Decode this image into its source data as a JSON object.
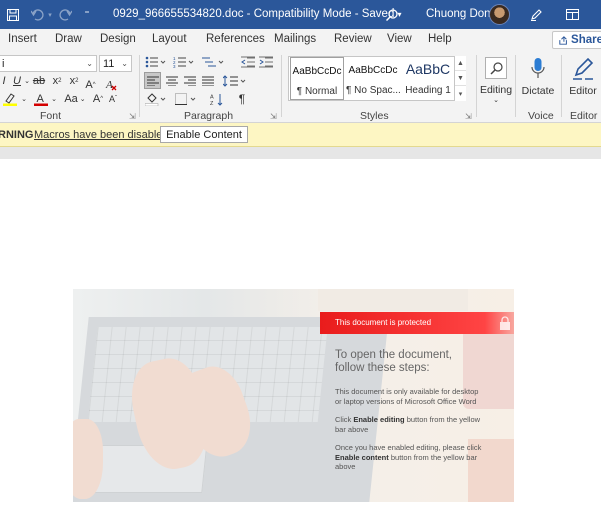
{
  "titlebar": {
    "filename": "0929_966655534820.doc",
    "separator": " - ",
    "mode": "Compatibility Mode",
    "separator2": " - ",
    "status": "Saved",
    "status_caret": "▾",
    "user": "Chuong Dong"
  },
  "tabs": [
    "Insert",
    "Draw",
    "Design",
    "Layout",
    "References",
    "Mailings",
    "Review",
    "View",
    "Help"
  ],
  "share_label": "Share",
  "ribbon": {
    "font_name": "i",
    "font_size": "11",
    "font_group": "Font",
    "paragraph_group": "Paragraph",
    "styles_group": "Styles",
    "voice_group": "Voice",
    "editor_group": "Editor",
    "editing_label": "Editing",
    "dictate_label": "Dictate",
    "editor_label": "Editor",
    "change_case": "Aa",
    "grow": "A",
    "shrink": "A",
    "styles": [
      {
        "preview": "AaBbCcDc",
        "name": "¶ Normal"
      },
      {
        "preview": "AaBbCcDc",
        "name": "¶ No Spac..."
      },
      {
        "preview": "AaBbC",
        "name": "Heading 1"
      }
    ]
  },
  "message_bar": {
    "warning": "RNING",
    "message": "Macros have been disabled.",
    "button": "Enable Content"
  },
  "document": {
    "banner": "This document is protected",
    "heading_line1": "To open the document,",
    "heading_line2": "follow these steps:",
    "para1_line1": "This document is only available for desktop",
    "para1_line2": "or laptop versions of Microsoft Office Word",
    "para2_pre": "Click ",
    "para2_bold": "Enable editing",
    "para2_post": " button from the yellow",
    "para2_line2": "bar above",
    "para3_line1": "Once you have enabled editing, please click",
    "para3_bold": "Enable content",
    "para3_post": " button from the yellow bar",
    "para3_line3": "above"
  },
  "colors": {
    "titlebar": "#2b579a",
    "ribbon": "#f3f3f3",
    "message_bar": "#fdf6c3",
    "banner_red": "#e91c1c"
  }
}
